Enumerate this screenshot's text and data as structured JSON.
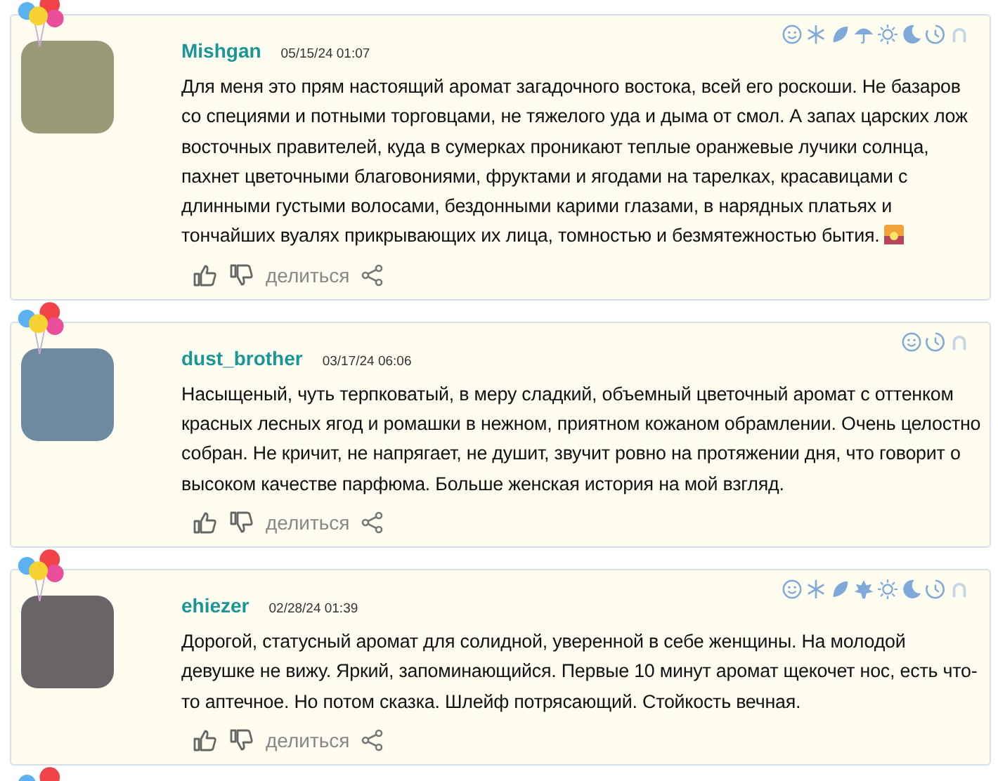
{
  "reviews": [
    {
      "author": "Mishgan",
      "date": "05/15/24 01:07",
      "text": "Для меня это прям настоящий аромат загадочного востока, всей его роскоши. Не базаров со специями и потными торговцами, не тяжелого уда и дыма от смол. А запах царских лож восточных правителей, куда в сумерках проникают теплые оранжевые лучики солнца, пахнет цветочными благовониями, фруктами и ягодами на тарелках, красавицами с длинными густыми волосами, бездонными карими глазами, в нарядных платьях и тончайших вуалях прикрывающих их лица, томностью и безмятежностью бытия.",
      "sunset_emoji": true,
      "share_label": "делиться",
      "icons": [
        {
          "kind": "smile"
        },
        {
          "kind": "snow"
        },
        {
          "kind": "leaf"
        },
        {
          "kind": "umbrella"
        },
        {
          "kind": "sun"
        },
        {
          "kind": "moon"
        },
        {
          "kind": "clock"
        },
        {
          "kind": "arch"
        }
      ]
    },
    {
      "author": "dust_brother",
      "date": "03/17/24 06:06",
      "text": "Насыщеный, чуть терпковатый, в меру сладкий, объемный цветочный аромат с оттенком красных лесных ягод и ромашки в нежном, приятном кожаном обрамлении. Очень целостно собран. Не кричит, не напрягает, не душит, звучит ровно на протяжении дня, что говорит о высоком качестве парфюма. Больше женская история на мой взгляд.",
      "sunset_emoji": false,
      "share_label": "делиться",
      "icons": [
        {
          "kind": "smile"
        },
        {
          "kind": "clock"
        },
        {
          "kind": "arch"
        }
      ]
    },
    {
      "author": "ehiezer",
      "date": "02/28/24 01:39",
      "text": "Дорогой, статусный аромат для солидной, уверенной в себе женщины. На молодой девушке не вижу. Яркий, запоминающийся. Первые 10 минут аромат щекочет нос, есть что-то аптечное. Но потом сказка. Шлейф потрясающий. Стойкость вечная.",
      "sunset_emoji": false,
      "share_label": "делиться",
      "icons": [
        {
          "kind": "smile"
        },
        {
          "kind": "snow"
        },
        {
          "kind": "leaf"
        },
        {
          "kind": "maple"
        },
        {
          "kind": "sun"
        },
        {
          "kind": "moon"
        },
        {
          "kind": "clock"
        },
        {
          "kind": "arch"
        }
      ]
    }
  ]
}
